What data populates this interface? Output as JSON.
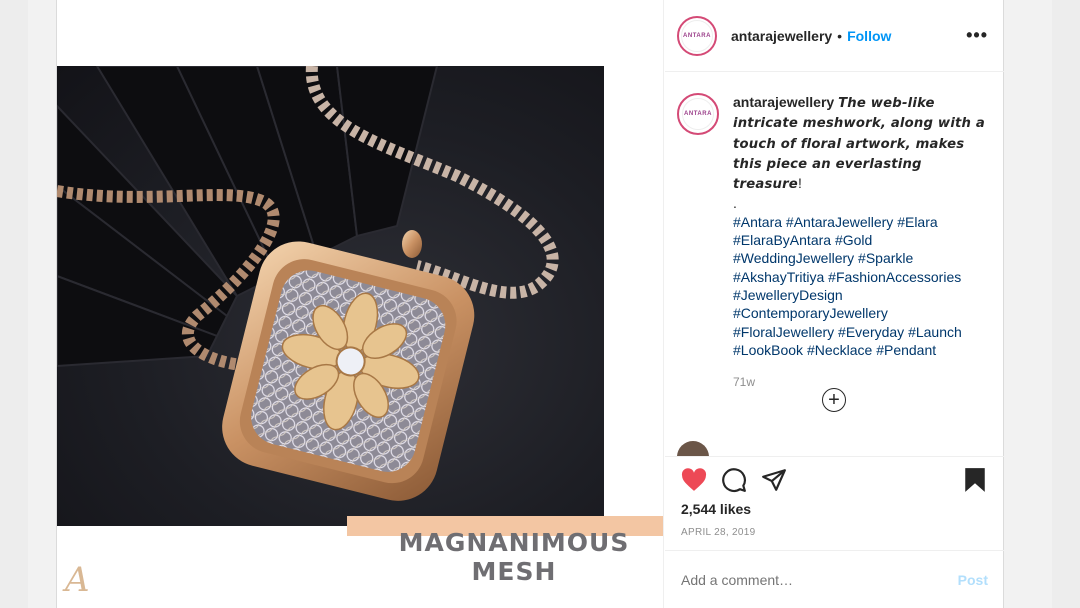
{
  "post": {
    "account": {
      "username": "antarajewellery",
      "avatar_text": "ANTARA",
      "separator": "•",
      "follow_label": "Follow",
      "more_icon": "more-horizontal-icon",
      "more_label": "•••"
    },
    "media": {
      "banner_line1": "MAGNANIMOUS",
      "banner_line2": "MESH",
      "brand_mark": "A"
    },
    "caption": {
      "username": "antarajewellery",
      "text_italic": "The web-like intricate meshwork, along with a touch of floral artwork, makes this piece an everlasting treasure",
      "text_end": "!",
      "dot_line": ".",
      "hashtags": "#Antara #AntaraJewellery #Elara #ElaraByAntara #Gold #WeddingJewellery #Sparkle #AkshayTritiya #FashionAccessories #JewelleryDesign #ContemporaryJewellery #FloralJewellery #Everyday #Launch #LookBook #Necklace #Pendant",
      "time": "71w"
    },
    "load_more_label": "+",
    "next_comment_user": "…",
    "actions": {
      "like_icon": "heart-filled-icon",
      "comment_icon": "comment-icon",
      "share_icon": "paper-plane-icon",
      "save_icon": "bookmark-filled-icon",
      "like_color": "#ed4956"
    },
    "likes": "2,544 likes",
    "date": "APRIL 28, 2019",
    "comment_box": {
      "placeholder": "Add a comment…",
      "post_label": "Post"
    }
  },
  "colors": {
    "follow": "#0095f6",
    "hashtag": "#00376b",
    "banner": "#f3c6a3",
    "muted": "#8e8e8e"
  }
}
